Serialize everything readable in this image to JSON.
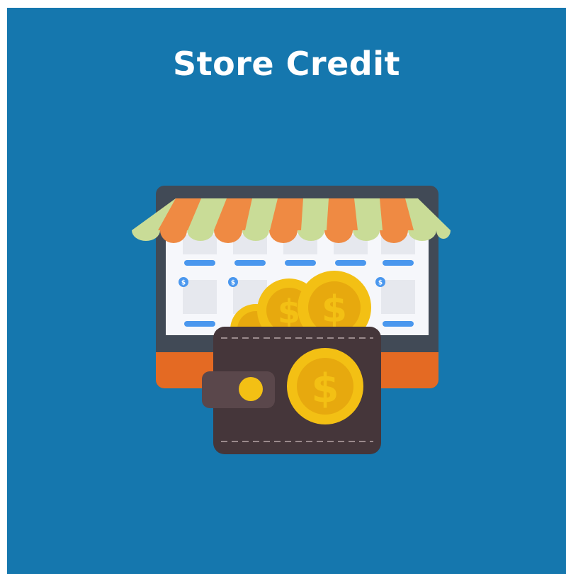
{
  "banner": {
    "title": "Store Credit",
    "background_color": "#1577ae",
    "title_color": "#ffffff"
  },
  "illustration": {
    "subject": "storefront-with-wallet-and-coins",
    "icons": [
      "storefront-icon",
      "awning-icon",
      "wallet-icon",
      "coin-icon"
    ],
    "colors": {
      "monitor_frame": "#414a56",
      "monitor_base": "#e46a23",
      "awning_orange": "#ef8a43",
      "awning_green": "#c9dc97",
      "wallet": "#45363a",
      "coin": "#f3c014",
      "accent_blue": "#4a97ee"
    }
  }
}
